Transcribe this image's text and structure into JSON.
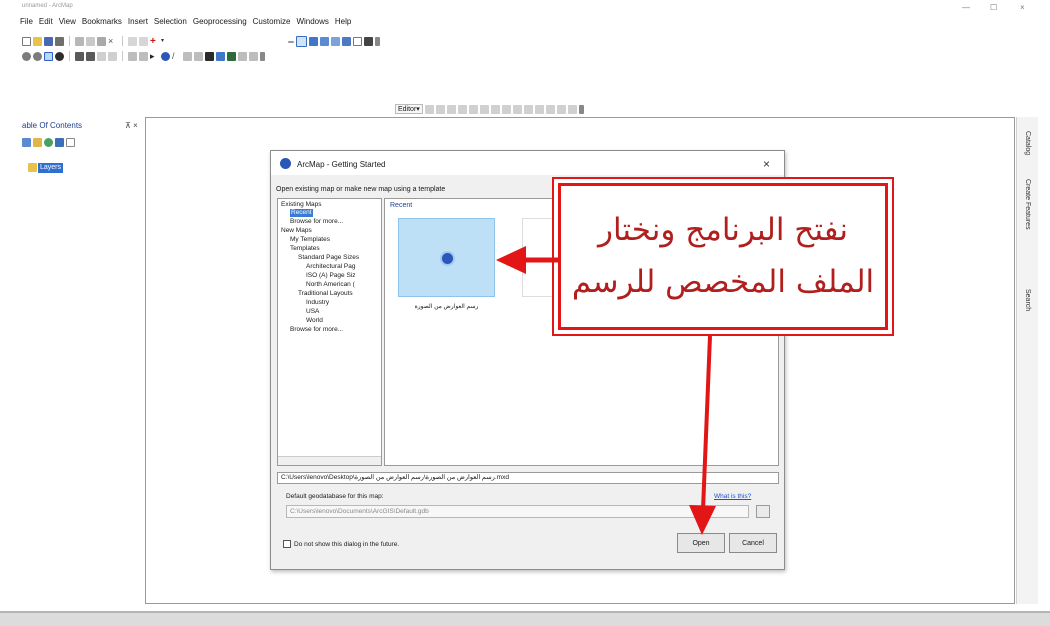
{
  "window": {
    "title": "unnamed - ArcMap",
    "controls": {
      "minimize": "—",
      "maximize": "☐",
      "close": "×"
    }
  },
  "menu": [
    "File",
    "Edit",
    "View",
    "Bookmarks",
    "Insert",
    "Selection",
    "Geoprocessing",
    "Customize",
    "Windows",
    "Help"
  ],
  "toolbar": {
    "editor_label": "Editor▾"
  },
  "toc": {
    "title": "able Of Contents",
    "pin": "⊼ ×",
    "layers": "Layers"
  },
  "right_tabs": [
    "Catalog",
    "Create Features",
    "Search"
  ],
  "dialog": {
    "title": "ArcMap - Getting Started",
    "close": "×",
    "instruction": "Open existing map or make new map using a template",
    "tree": {
      "existing_maps": "Existing Maps",
      "recent": "Recent",
      "browse1": "Browse for more...",
      "new_maps": "New Maps",
      "my_templates": "My Templates",
      "templates": "Templates",
      "standard_page_sizes": "Standard Page Sizes",
      "architectural": "Architectural Pag",
      "iso": "ISO (A) Page Siz",
      "north_american": "North American (",
      "traditional_layouts": "Traditional Layouts",
      "industry": "Industry",
      "usa": "USA",
      "world": "World",
      "browse2": "Browse for more..."
    },
    "recent_label": "Recent",
    "thumbnail_caption": "رسم العوارض من الصورة",
    "path": "C:\\Users\\lenovo\\Desktop\\رسم العوارض من الصورة\\رسم العوارض من الصورة.mxd",
    "gdb_label": "Default geodatabase for this map:",
    "whats_this": "What is this?",
    "gdb_path": "C:\\Users\\lenovo\\Documents\\ArcGIS\\Default.gdb",
    "dont_show": "Do not show this dialog in the future.",
    "open_button": "Open",
    "cancel_button": "Cancel"
  },
  "annotation": {
    "line1": "نفتح البرنامج ونختار",
    "line2": "الملف المخصص للرسم",
    "color": "#e21616"
  }
}
